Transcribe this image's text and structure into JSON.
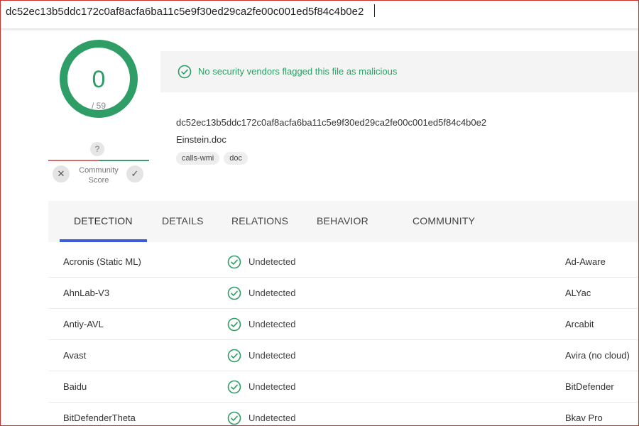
{
  "search": {
    "query": "dc52ec13b5ddc172c0af8acfa6ba11c5e9f30ed29ca2fe00c001ed5f84c4b0e2"
  },
  "score": {
    "detections": "0",
    "total": "/ 59"
  },
  "community": {
    "unknown_badge": "?",
    "label": "Community Score",
    "vote_down_icon": "✕",
    "vote_up_icon": "✓"
  },
  "status": {
    "message": "No security vendors flagged this file as malicious",
    "color": "#2e9d66"
  },
  "file": {
    "hash": "dc52ec13b5ddc172c0af8acfa6ba11c5e9f30ed29ca2fe00c001ed5f84c4b0e2",
    "name": "Einstein.doc",
    "tags": [
      "calls-wmi",
      "doc"
    ]
  },
  "tabs": [
    "DETECTION",
    "DETAILS",
    "RELATIONS",
    "BEHAVIOR",
    "COMMUNITY"
  ],
  "active_tab_color": "#3b5bdb",
  "detections": [
    {
      "engine": "Acronis (Static ML)",
      "result": "Undetected",
      "engine_right": "Ad-Aware"
    },
    {
      "engine": "AhnLab-V3",
      "result": "Undetected",
      "engine_right": "ALYac"
    },
    {
      "engine": "Antiy-AVL",
      "result": "Undetected",
      "engine_right": "Arcabit"
    },
    {
      "engine": "Avast",
      "result": "Undetected",
      "engine_right": "Avira (no cloud)"
    },
    {
      "engine": "Baidu",
      "result": "Undetected",
      "engine_right": "BitDefender"
    },
    {
      "engine": "BitDefenderTheta",
      "result": "Undetected",
      "engine_right": "Bkav Pro"
    }
  ]
}
